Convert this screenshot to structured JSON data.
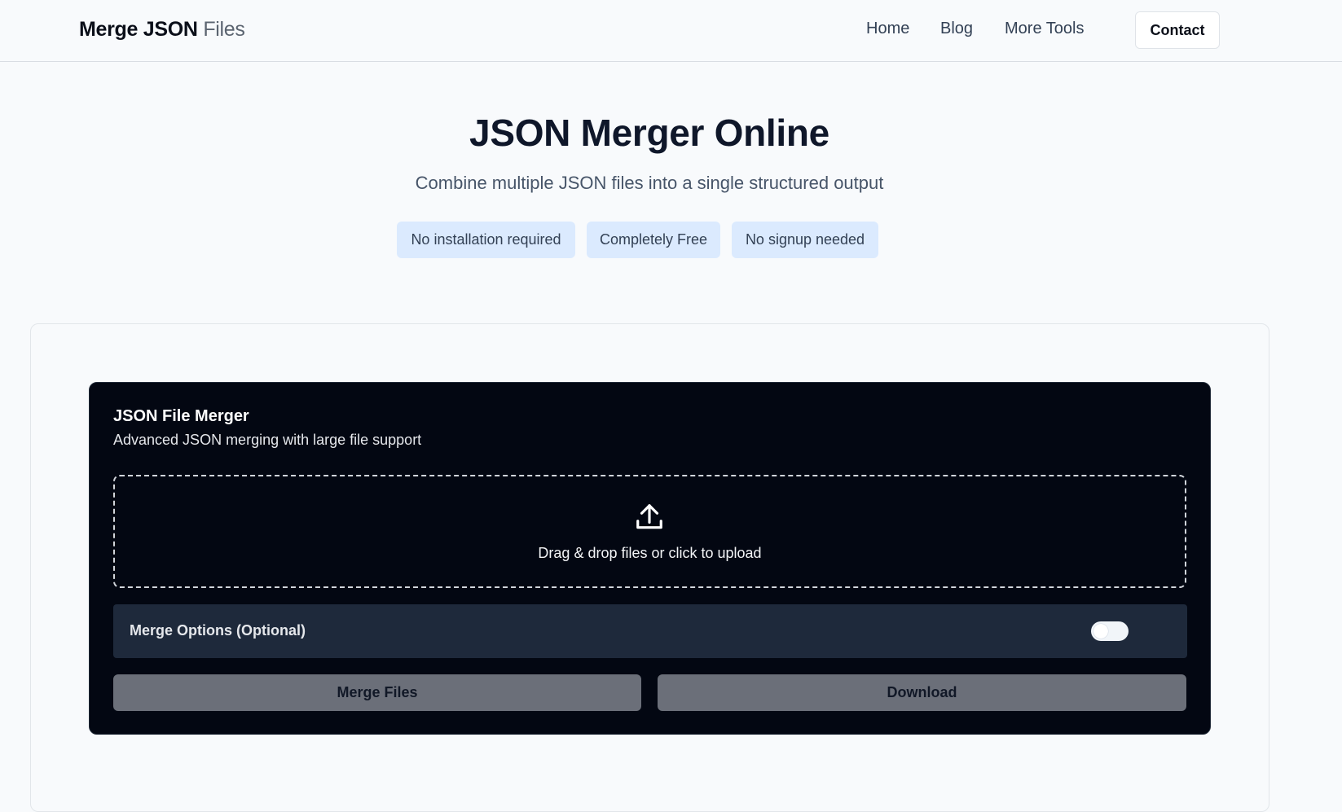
{
  "header": {
    "brand_bold": "Merge JSON",
    "brand_light": "Files",
    "nav": [
      "Home",
      "Blog",
      "More Tools"
    ],
    "contact_label": "Contact"
  },
  "hero": {
    "title": "JSON Merger Online",
    "subtitle": "Combine multiple JSON files into a single structured output",
    "pills": [
      "No installation required",
      "Completely Free",
      "No signup needed"
    ]
  },
  "tool": {
    "title": "JSON File Merger",
    "subtitle": "Advanced JSON merging with large file support",
    "upload_icon": "upload-icon",
    "drop_text": "Drag & drop files or click to upload",
    "options_label": "Merge Options (Optional)",
    "options_enabled": false,
    "merge_label": "Merge Files",
    "download_label": "Download"
  },
  "colors": {
    "panel_bg": "#030712",
    "pill_bg": "#dbeafe",
    "button_bg": "#6b6f79"
  }
}
